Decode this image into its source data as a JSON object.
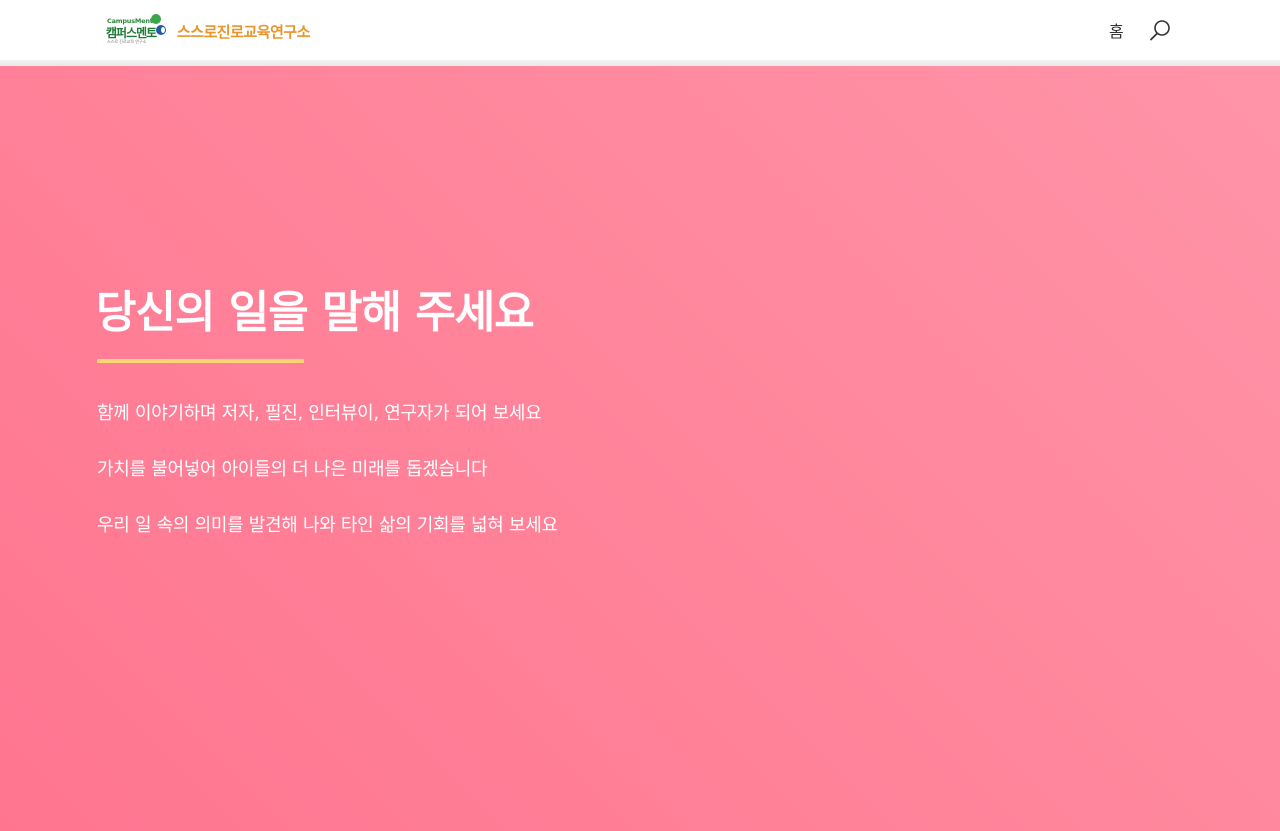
{
  "header": {
    "logo": {
      "english": "CampusMentor",
      "korean": "캠퍼스멘토",
      "tagline": "스스로 진로교육 연구소",
      "name": "스스로진로교육연구소"
    },
    "nav": {
      "home_label": "홈"
    },
    "search_icon": "search-icon"
  },
  "hero": {
    "title": "당신의 일을 말해 주세요",
    "lines": [
      "함께 이야기하며 저자,  필진,  인터뷰이,  연구자가 되어 보세요",
      "가치를 불어넣어 아이들의 더 나은 미래를 돕겠습니다",
      "우리 일 속의 의미를 발견해 나와 타인 삶의 기회를 넓혀 보세요"
    ]
  },
  "colors": {
    "hero_gradient_start": "#ff94a8",
    "hero_gradient_end": "#ff7590",
    "underline": "#f7d673",
    "logo_text": "#e8952a",
    "logo_green": "#2a8a3a",
    "logo_blue": "#1f5aa6"
  }
}
